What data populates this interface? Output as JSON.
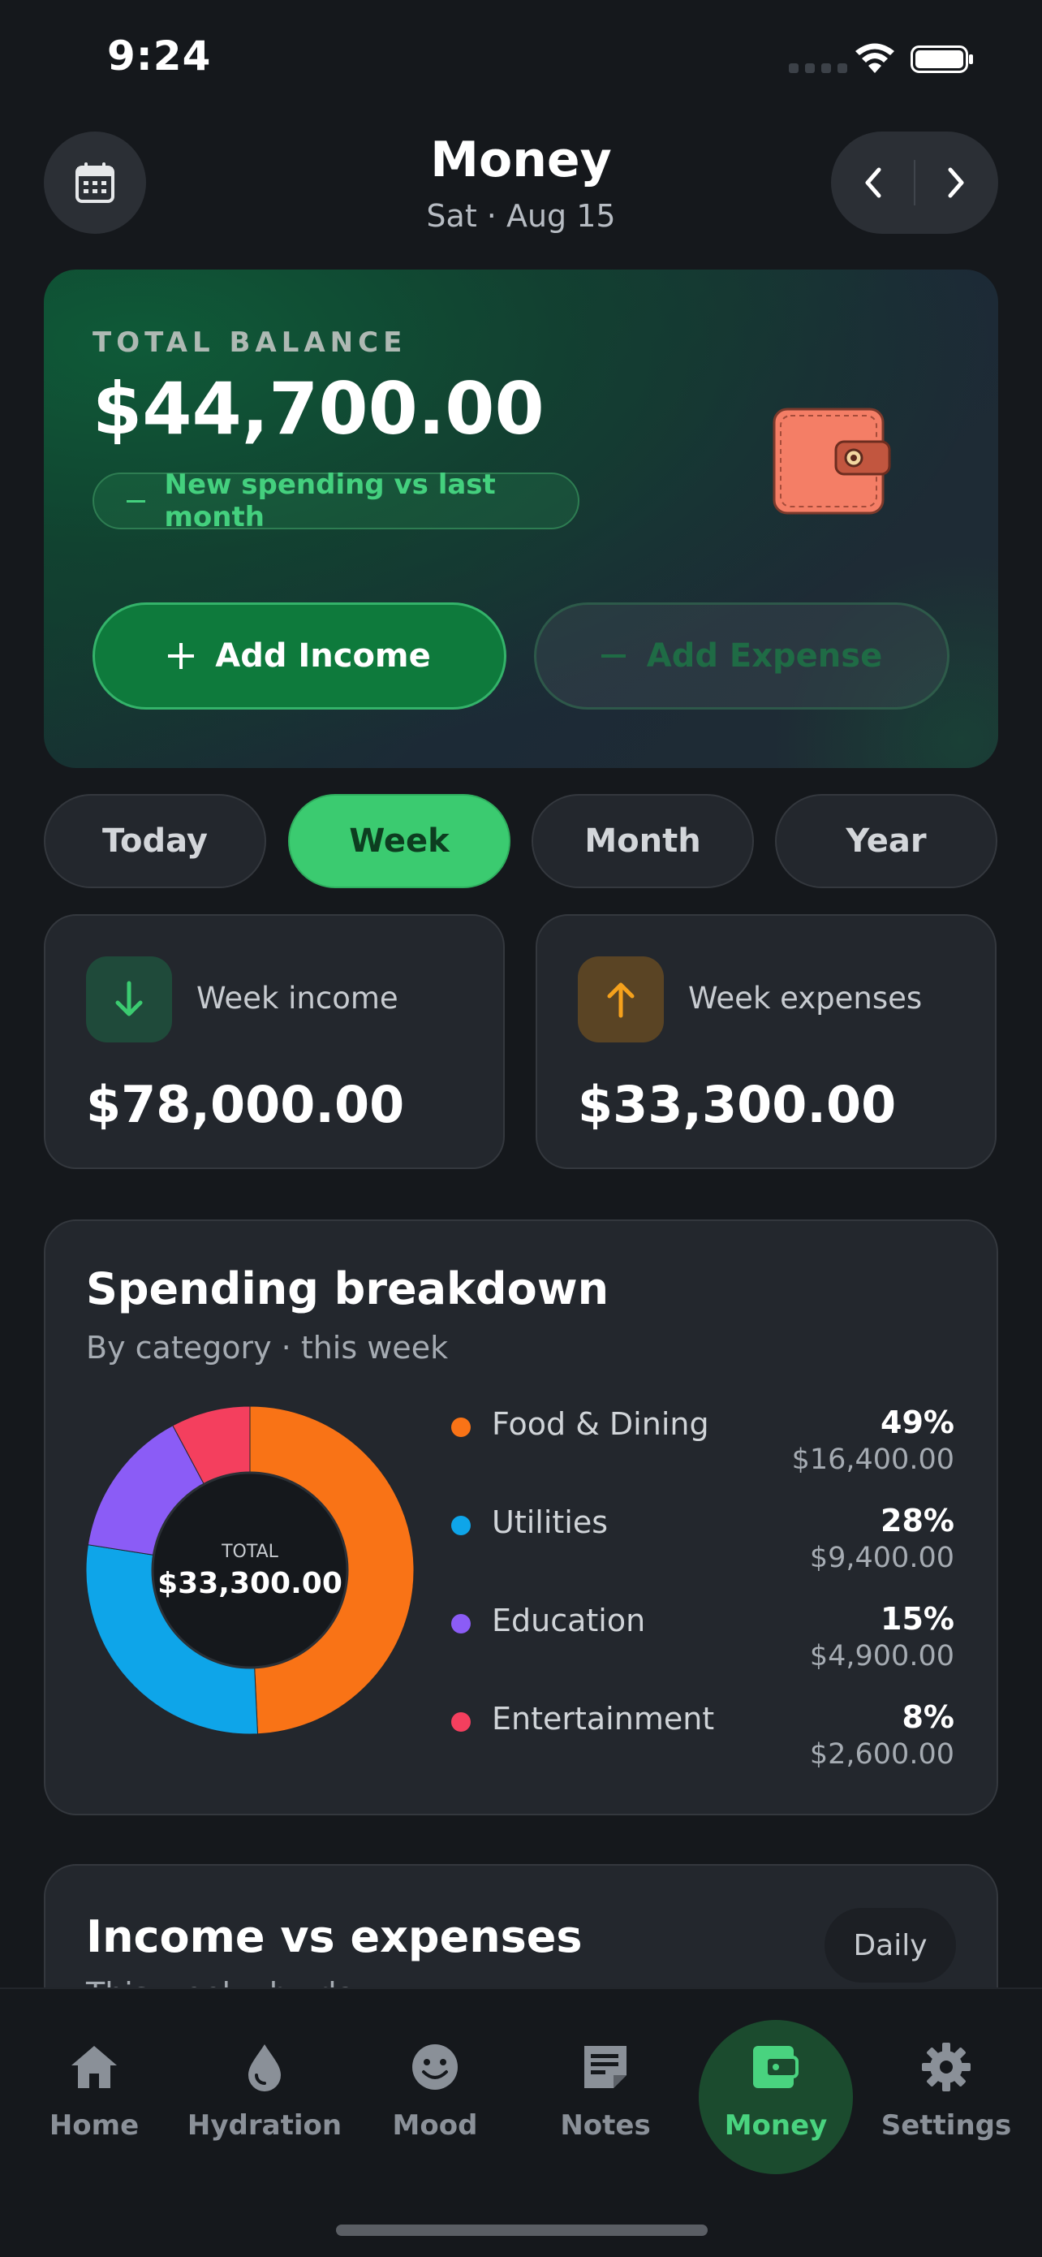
{
  "status_bar": {
    "time": "9:24"
  },
  "header": {
    "title": "Money",
    "date": "Sat · Aug 15",
    "icons": {
      "calendar": "calendar-icon",
      "prev": "chevron-left-icon",
      "next": "chevron-right-icon"
    }
  },
  "balance": {
    "label": "TOTAL BALANCE",
    "value": "$44,700.00",
    "trend": "New spending vs last month",
    "add_income": "Add Income",
    "add_expense": "Add Expense"
  },
  "periods": [
    {
      "label": "Today",
      "active": false
    },
    {
      "label": "Week",
      "active": true
    },
    {
      "label": "Month",
      "active": false
    },
    {
      "label": "Year",
      "active": false
    }
  ],
  "stats": {
    "income": {
      "label": "Week income",
      "value": "$78,000.00",
      "color": "#3bcb70"
    },
    "expenses": {
      "label": "Week expenses",
      "value": "$33,300.00",
      "color": "#f5a11c"
    }
  },
  "chart_data": {
    "type": "pie",
    "title": "Spending breakdown",
    "subtitle": "By category · this week",
    "center_label": "TOTAL",
    "center_value": "$33,300.00",
    "slices": [
      {
        "name": "Food & Dining",
        "percent": "49%",
        "amount": "$16,400.00",
        "value": 16400,
        "color": "#f97316"
      },
      {
        "name": "Utilities",
        "percent": "28%",
        "amount": "$9,400.00",
        "value": 9400,
        "color": "#0ea5e9"
      },
      {
        "name": "Education",
        "percent": "15%",
        "amount": "$4,900.00",
        "value": 4900,
        "color": "#8b5cf6"
      },
      {
        "name": "Entertainment",
        "percent": "8%",
        "amount": "$2,600.00",
        "value": 2600,
        "color": "#f43f5e"
      }
    ]
  },
  "income_vs_expenses": {
    "title": "Income vs expenses",
    "subtitle": "This week · by day",
    "toggle": "Daily"
  },
  "nav": [
    {
      "label": "Home",
      "icon": "home-icon",
      "active": false
    },
    {
      "label": "Hydration",
      "icon": "water-drop-icon",
      "active": false
    },
    {
      "label": "Mood",
      "icon": "smiley-icon",
      "active": false
    },
    {
      "label": "Notes",
      "icon": "notes-icon",
      "active": false
    },
    {
      "label": "Money",
      "icon": "wallet-icon",
      "active": true
    },
    {
      "label": "Settings",
      "icon": "gear-icon",
      "active": false
    }
  ]
}
